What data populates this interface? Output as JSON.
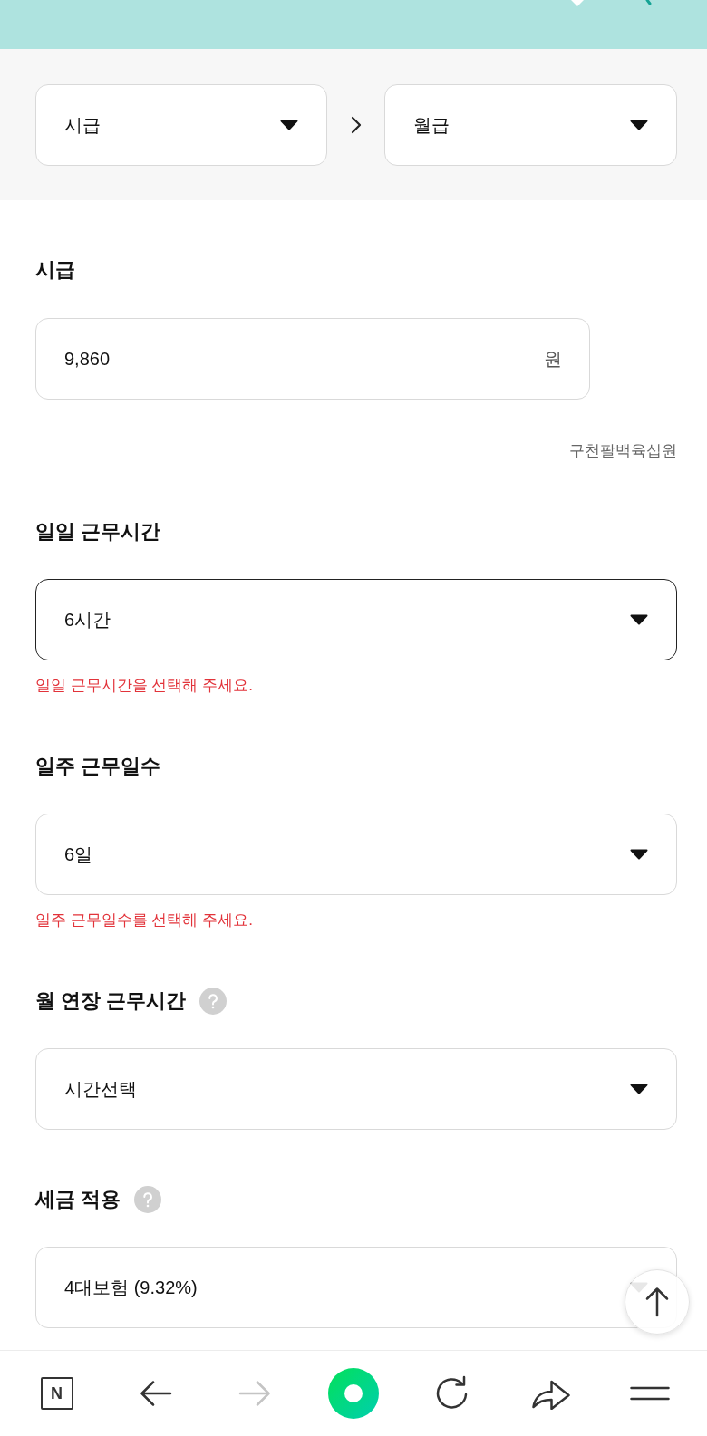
{
  "conversion": {
    "from": "시급",
    "to": "월급"
  },
  "fields": [
    {
      "kind": "input",
      "label": "시급",
      "help": false,
      "value": "9,860",
      "unit": "원",
      "hint": "구천팔백육십원"
    },
    {
      "kind": "select",
      "label": "일일 근무시간",
      "help": false,
      "value": "6시간",
      "focused": true,
      "error": "일일 근무시간을 선택해 주세요."
    },
    {
      "kind": "select",
      "label": "일주 근무일수",
      "help": false,
      "value": "6일",
      "focused": false,
      "error": "일주 근무일수를 선택해 주세요."
    },
    {
      "kind": "select",
      "label": "월 연장 근무시간",
      "help": true,
      "value": "시간선택",
      "focused": false
    },
    {
      "kind": "select",
      "label": "세금 적용",
      "help": true,
      "value": "4대보험 (9.32%)",
      "focused": false
    }
  ],
  "bottom_nav": [
    {
      "kind": "logo",
      "label": "N",
      "disabled": false
    },
    {
      "kind": "back",
      "disabled": false
    },
    {
      "kind": "forward",
      "disabled": true
    },
    {
      "kind": "green",
      "disabled": false
    },
    {
      "kind": "reload",
      "disabled": false
    },
    {
      "kind": "share",
      "disabled": false
    },
    {
      "kind": "menu",
      "disabled": false
    }
  ]
}
